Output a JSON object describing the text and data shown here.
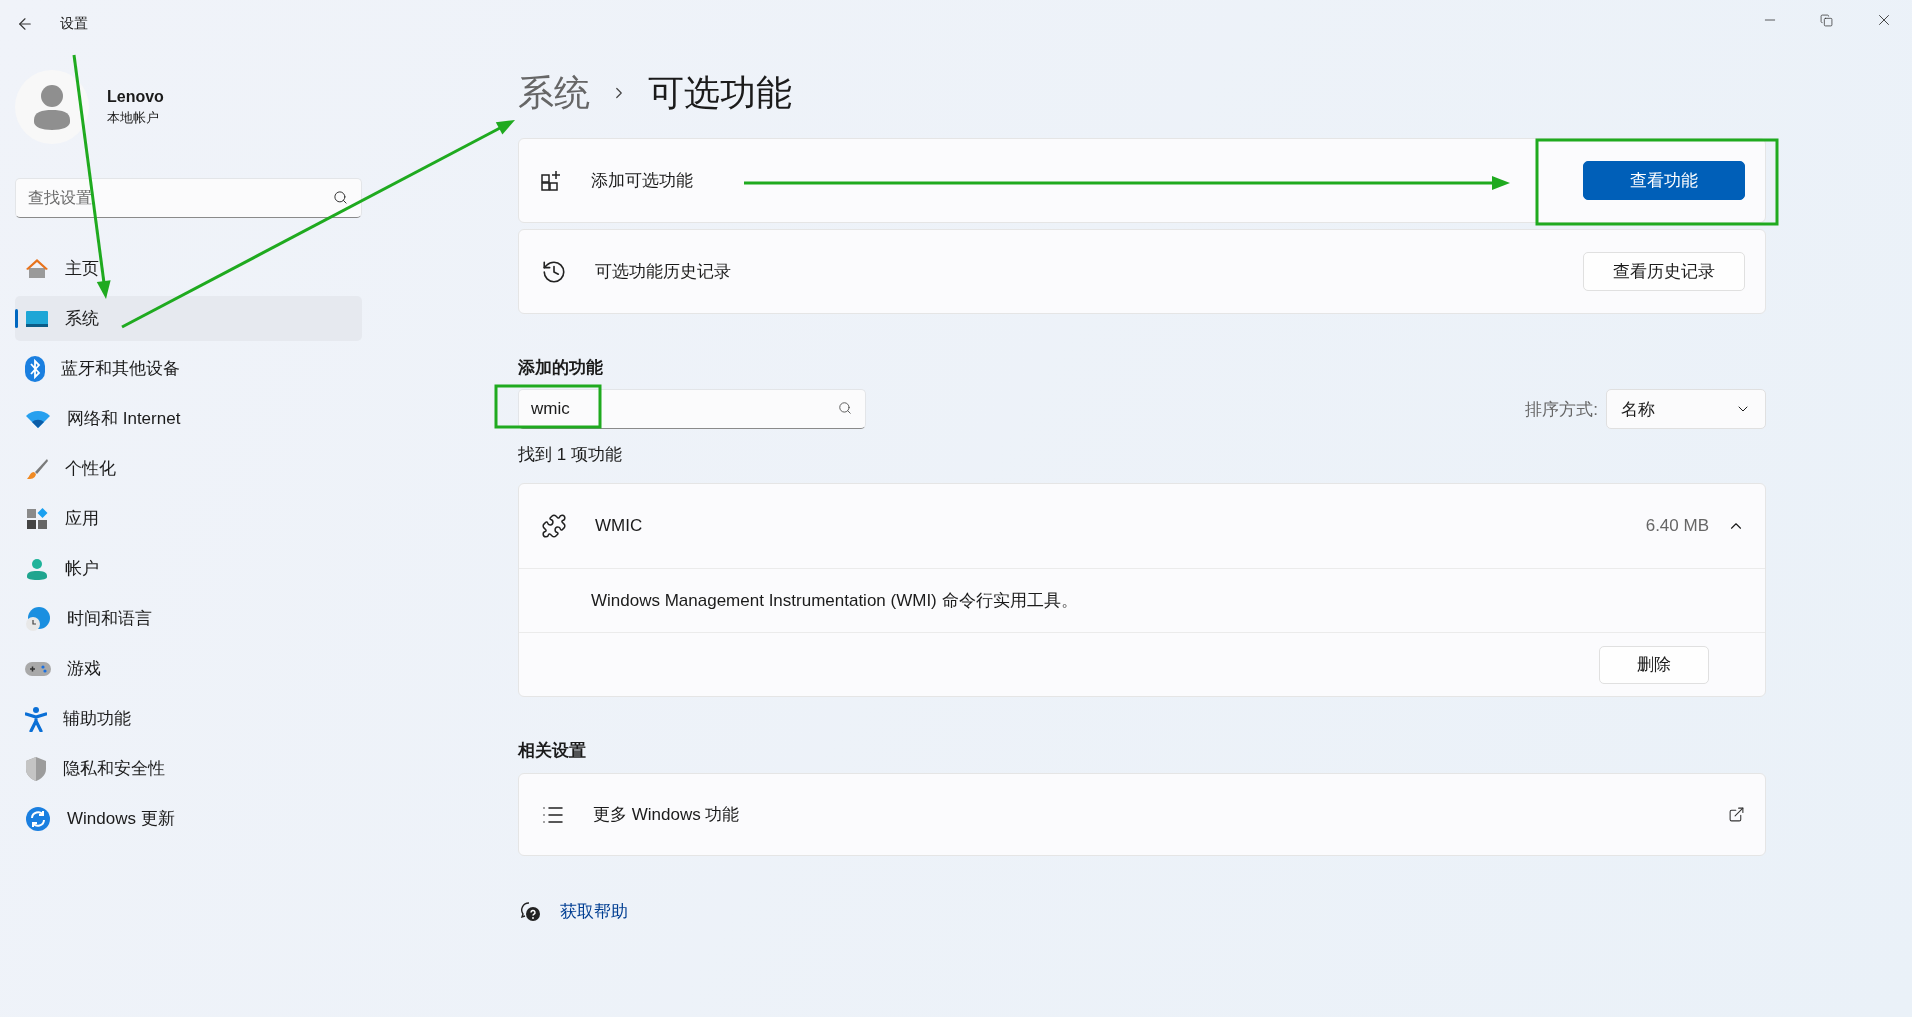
{
  "window": {
    "title": "设置"
  },
  "user": {
    "name": "Lenovo",
    "account_type": "本地帐户"
  },
  "sidebar": {
    "search": {
      "placeholder": "查找设置"
    },
    "items": [
      {
        "label": "主页",
        "selected": false
      },
      {
        "label": "系统",
        "selected": true
      },
      {
        "label": "蓝牙和其他设备",
        "selected": false
      },
      {
        "label": "网络和 Internet",
        "selected": false
      },
      {
        "label": "个性化",
        "selected": false
      },
      {
        "label": "应用",
        "selected": false
      },
      {
        "label": "帐户",
        "selected": false
      },
      {
        "label": "时间和语言",
        "selected": false
      },
      {
        "label": "游戏",
        "selected": false
      },
      {
        "label": "辅助功能",
        "selected": false
      },
      {
        "label": "隐私和安全性",
        "selected": false
      },
      {
        "label": "Windows 更新",
        "selected": false
      }
    ]
  },
  "breadcrumb": {
    "parent": "系统",
    "current": "可选功能"
  },
  "cards": [
    {
      "label": "添加可选功能",
      "button": {
        "label": "查看功能",
        "primary": true
      }
    },
    {
      "label": "可选功能历史记录",
      "button": {
        "label": "查看历史记录",
        "primary": false
      }
    }
  ],
  "added_features": {
    "heading": "添加的功能",
    "search": {
      "value": "wmic"
    },
    "sort": {
      "label": "排序方式:",
      "value": "名称"
    },
    "result_count": "找到 1 项功能",
    "items": [
      {
        "name": "WMIC",
        "size": "6.40 MB",
        "expanded": true,
        "description": "Windows Management Instrumentation (WMI) 命令行实用工具。",
        "action": "删除"
      }
    ]
  },
  "related": {
    "heading": "相关设置",
    "items": [
      {
        "label": "更多 Windows 功能"
      }
    ]
  },
  "help": {
    "label": "获取帮助"
  }
}
